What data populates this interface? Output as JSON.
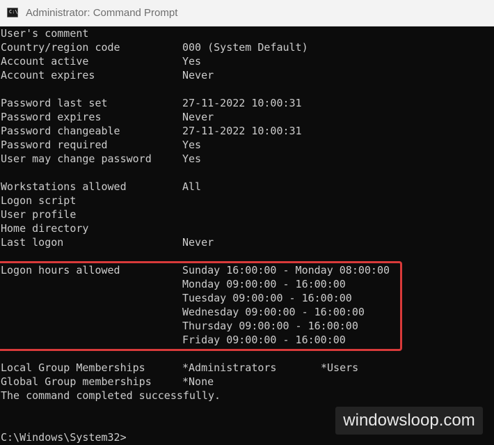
{
  "window": {
    "title": "Administrator: Command Prompt",
    "icon": "cmd-icon",
    "icon_glyph": "C:\\_"
  },
  "colors": {
    "console_background": "#0c0c0c",
    "console_text": "#cccccc",
    "titlebar_background": "#f3f3f3",
    "highlight_border": "#d93a3a"
  },
  "console": {
    "rows": [
      {
        "label": "User's comment",
        "value": ""
      },
      {
        "label": "Country/region code",
        "value": "000 (System Default)"
      },
      {
        "label": "Account active",
        "value": "Yes"
      },
      {
        "label": "Account expires",
        "value": "Never"
      },
      {
        "label": "",
        "value": ""
      },
      {
        "label": "Password last set",
        "value": "27-11-2022 10:00:31"
      },
      {
        "label": "Password expires",
        "value": "Never"
      },
      {
        "label": "Password changeable",
        "value": "27-11-2022 10:00:31"
      },
      {
        "label": "Password required",
        "value": "Yes"
      },
      {
        "label": "User may change password",
        "value": "Yes"
      },
      {
        "label": "",
        "value": ""
      },
      {
        "label": "Workstations allowed",
        "value": "All"
      },
      {
        "label": "Logon script",
        "value": ""
      },
      {
        "label": "User profile",
        "value": ""
      },
      {
        "label": "Home directory",
        "value": ""
      },
      {
        "label": "Last logon",
        "value": "Never"
      }
    ],
    "logon_hours": {
      "label": "Logon hours allowed",
      "values": [
        "Sunday 16:00:00 - Monday 08:00:00",
        "Monday 09:00:00 - 16:00:00",
        "Tuesday 09:00:00 - 16:00:00",
        "Wednesday 09:00:00 - 16:00:00",
        "Thursday 09:00:00 - 16:00:00",
        "Friday 09:00:00 - 16:00:00"
      ]
    },
    "local_groups": {
      "label": "Local Group Memberships",
      "values": [
        "*Administrators",
        "*Users"
      ]
    },
    "global_groups": {
      "label": "Global Group memberships",
      "value": "*None"
    },
    "completion_message": "The command completed successfully.",
    "prompt": "C:\\Windows\\System32>"
  },
  "watermark": {
    "text": "windowsloop.com"
  }
}
